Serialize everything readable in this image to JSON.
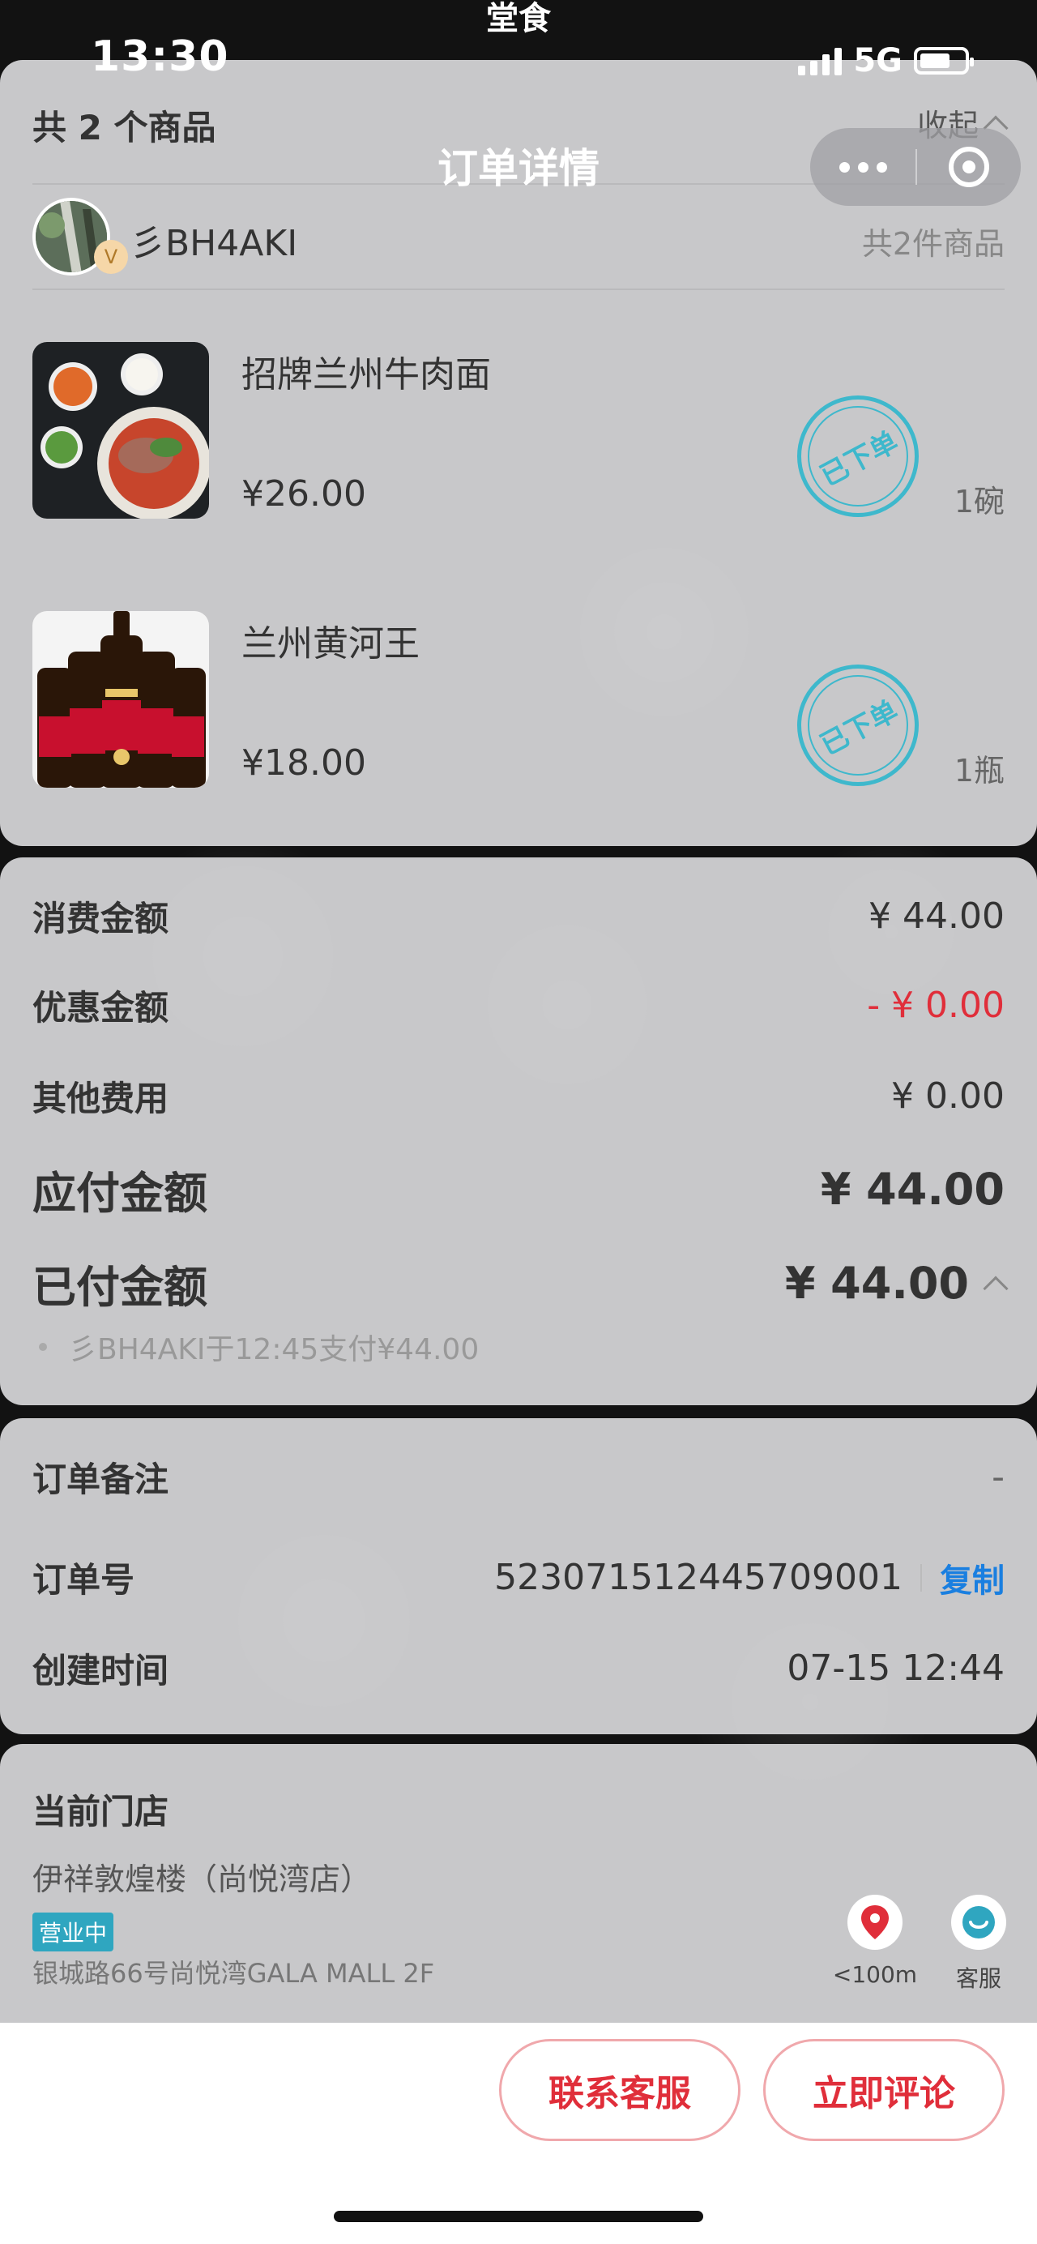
{
  "status_bar": {
    "time": "13:30",
    "network": "5G"
  },
  "partial_title": "堂食",
  "nav": {
    "title": "订单详情"
  },
  "items_header": {
    "count_text": "共 2 个商品",
    "collapse": "收起"
  },
  "orderer": {
    "name": "彡BH4AKI",
    "badge": "V",
    "summary": "共2件商品"
  },
  "products": [
    {
      "name": "招牌兰州牛肉面",
      "price": "¥26.00",
      "qty": "1碗",
      "stamp": "已下单"
    },
    {
      "name": "兰州黄河王",
      "price": "¥18.00",
      "qty": "1瓶",
      "stamp": "已下单"
    }
  ],
  "amounts": {
    "consume_label": "消费金额",
    "consume_value": "¥ 44.00",
    "discount_label": "优惠金额",
    "discount_value": "- ¥ 0.00",
    "other_label": "其他费用",
    "other_value": "¥ 0.00",
    "payable_label": "应付金额",
    "payable_value": "¥ 44.00",
    "paid_label": "已付金额",
    "paid_value": "¥ 44.00",
    "paid_detail": "彡BH4AKI于12:45支付¥44.00"
  },
  "order_info": {
    "note_label": "订单备注",
    "note_value": "-",
    "number_label": "订单号",
    "number_value": "523071512445709001",
    "copy": "复制",
    "created_label": "创建时间",
    "created_value": "07-15 12:44"
  },
  "store": {
    "section_label": "当前门店",
    "name": "伊祥敦煌楼（尚悦湾店）",
    "status_badge": "营业中",
    "address": "银城路66号尚悦湾GALA MALL 2F",
    "distance": "<100m",
    "service": "客服"
  },
  "actions": {
    "contact": "联系客服",
    "review": "立即评论"
  },
  "colors": {
    "accent_red": "#e02e3a",
    "stamp_teal": "#3eb8cc",
    "link_blue": "#1a7fe0",
    "badge_teal": "#2fa6c0"
  }
}
